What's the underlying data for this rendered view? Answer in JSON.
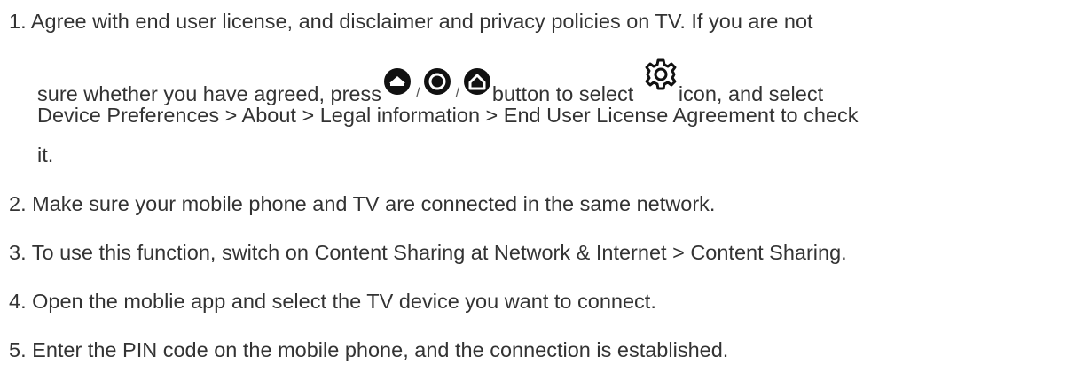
{
  "steps": [
    {
      "number": "1.",
      "line1": "Agree with end user license, and disclaimer and privacy policies on TV. If you are not",
      "line2_before_icons": "sure whether you have agreed, press",
      "icon_separator": "/",
      "line2_between": "button to select",
      "line2_after_gear": "icon, and select",
      "line3": "Device Preferences > About > Legal information > End User License Agreement to check",
      "line4": "it.",
      "icons": [
        "home-button-icon-variant-a",
        "home-button-icon-variant-b",
        "home-button-icon-variant-c",
        "gear-icon"
      ]
    },
    {
      "number": "2.",
      "text": "Make sure your mobile phone and TV are connected in the same network."
    },
    {
      "number": "3.",
      "text": "To use this function, switch on Content Sharing at Network & Internet > Content Sharing."
    },
    {
      "number": "4.",
      "text": "Open the moblie app and select the TV device you want to connect."
    },
    {
      "number": "5.",
      "text": "Enter the PIN code on the mobile phone, and the connection is established."
    }
  ]
}
